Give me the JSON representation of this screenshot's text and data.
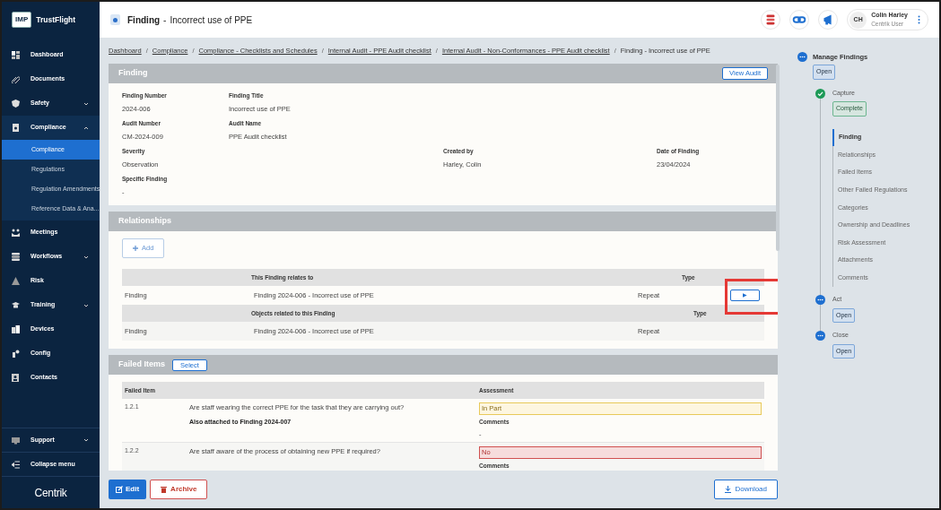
{
  "sidebar": {
    "logo": "IMP",
    "brand": "TrustFlight",
    "items": [
      {
        "label": "Dashboard"
      },
      {
        "label": "Documents"
      },
      {
        "label": "Safety",
        "expanded": false
      },
      {
        "label": "Compliance",
        "expanded": true,
        "children": [
          {
            "label": "Compliance",
            "selected": true
          },
          {
            "label": "Regulations",
            "selected": false
          },
          {
            "label": "Regulation Amendments",
            "selected": false
          },
          {
            "label": "Reference Data & Ana...",
            "selected": false
          }
        ]
      },
      {
        "label": "Meetings"
      },
      {
        "label": "Workflows",
        "expanded": false
      },
      {
        "label": "Risk"
      },
      {
        "label": "Training",
        "expanded": false
      },
      {
        "label": "Devices"
      },
      {
        "label": "Config"
      },
      {
        "label": "Contacts"
      }
    ],
    "footer_items": [
      {
        "label": "Support",
        "expanded": false
      },
      {
        "label": "Collapse menu"
      }
    ],
    "footer_logo": "Centrik"
  },
  "header": {
    "title": "Finding",
    "separator": "-",
    "subtitle": "Incorrect use of PPE",
    "user": {
      "initials": "CH",
      "name": "Colin Harley",
      "role": "Centrik User"
    }
  },
  "breadcrumbs": [
    {
      "label": "Dashboard",
      "link": true
    },
    {
      "separator": "/",
      "label": "Compliance",
      "link": true
    },
    {
      "separator": "/",
      "label": "Compliance - Checklists and Schedules",
      "link": true
    },
    {
      "separator": "/",
      "label": "Internal Audit - PPE Audit checklist",
      "link": true
    },
    {
      "separator": "/",
      "label": "Internal Audit - Non-Conformances - PPE Audit checklist",
      "link": true
    },
    {
      "separator": "/",
      "label": "Finding - Incorrect use of PPE",
      "link": false
    }
  ],
  "finding": {
    "title": "Finding",
    "button": "View Audit",
    "rows": [
      [
        {
          "label": "Finding Number",
          "value": "2024-006"
        },
        {
          "label": "Finding Title",
          "value": "Incorrect use of PPE"
        },
        null,
        null
      ],
      [
        {
          "label": "Audit Number",
          "value": "CM-2024-009"
        },
        {
          "label": "Audit Name",
          "value": "PPE Audit checklist"
        },
        null,
        null
      ],
      [
        {
          "label": "Severity",
          "value": "Observation"
        },
        null,
        {
          "label": "Created by",
          "value": "Harley, Colin"
        },
        {
          "label": "Date of Finding",
          "value": "23/04/2024"
        }
      ],
      [
        {
          "label": "Specific Finding",
          "value": "-"
        },
        null,
        null,
        null
      ]
    ]
  },
  "relationships": {
    "title": "Relationships",
    "add_button": "Add",
    "groups": [
      {
        "heading": "This Finding relates to",
        "type_heading": "Type",
        "rows": [
          {
            "column_1": "Finding",
            "object": "Finding 2024-006 - Incorrect use of PPE",
            "type": "Repeat",
            "action": "▶"
          }
        ]
      },
      {
        "heading": "Objects related to this Finding",
        "type_heading": "Type",
        "rows": [
          {
            "column_1": "Finding",
            "object": "Finding 2024-006 - Incorrect use of PPE",
            "type": "Repeat"
          }
        ]
      }
    ]
  },
  "failed_items": {
    "title": "Failed Items",
    "select_button": "Select",
    "columns": [
      "Failed Item",
      "Assessment"
    ],
    "rows": [
      {
        "number": "1.2.1",
        "question": "Are staff wearing the correct PPE for the task that they are carrying out?",
        "note": "Also attached to Finding 2024-007",
        "assessment": "In Part",
        "kind": "partial",
        "comments_label": "Comments",
        "comments": "-"
      },
      {
        "number": "1.2.2",
        "question": "Are staff aware of the process of obtaining new PPE if required?",
        "assessment": "No",
        "kind": "fail",
        "comments_label": "Comments"
      }
    ]
  },
  "footer": {
    "edit": "Edit",
    "archive": "Archive",
    "download": "Download"
  },
  "workflow": {
    "title": "Manage Findings",
    "status": "Open",
    "kind": "open",
    "stages": [
      {
        "title": "Capture",
        "status": "Complete",
        "kind": "complete",
        "steps": [
          {
            "label": "Finding",
            "selected": true
          },
          {
            "label": "Relationships",
            "selected": false
          },
          {
            "label": "Failed Items",
            "selected": false
          },
          {
            "label": "Other Failed Regulations",
            "selected": false
          },
          {
            "label": "Categories",
            "selected": false
          },
          {
            "label": "Ownership and Deadlines",
            "selected": false
          },
          {
            "label": "Risk Assessment",
            "selected": false
          },
          {
            "label": "Attachments",
            "selected": false
          },
          {
            "label": "Comments",
            "selected": false
          }
        ]
      },
      {
        "title": "Act",
        "status": "Open",
        "kind": "open"
      },
      {
        "title": "Close",
        "status": "Open",
        "kind": "open"
      }
    ]
  }
}
